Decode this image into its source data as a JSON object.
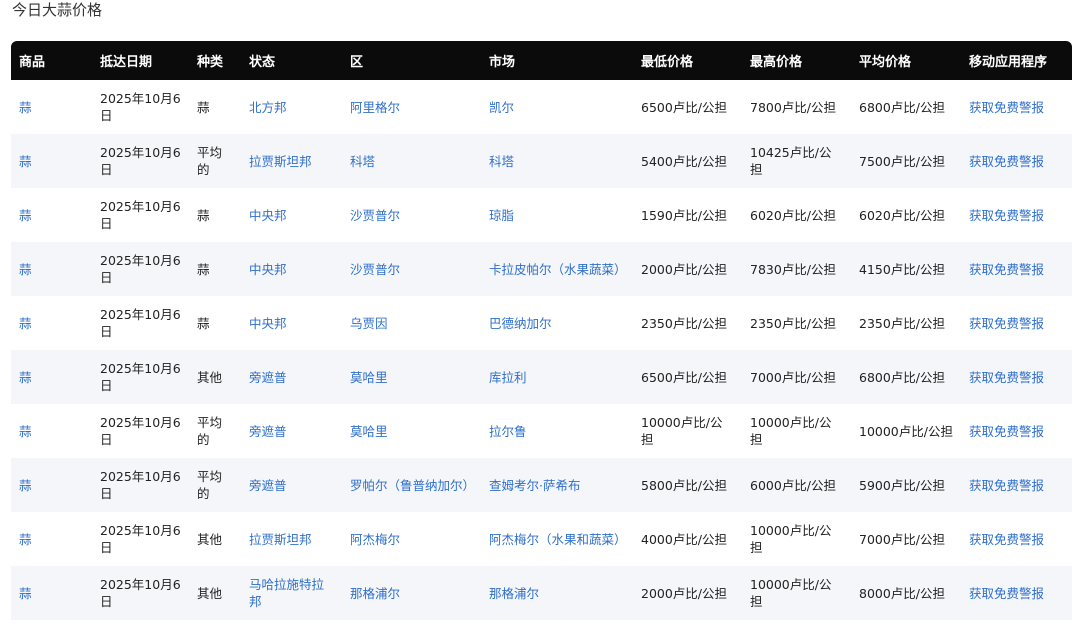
{
  "page": {
    "title": "今日大蒜价格"
  },
  "table": {
    "headers": [
      "商品",
      "抵达日期",
      "种类",
      "状态",
      "区",
      "市场",
      "最低价格",
      "最高价格",
      "平均价格",
      "移动应用程序"
    ],
    "rows": [
      [
        "蒜",
        "2025年10月6日",
        "蒜",
        "北方邦",
        "阿里格尔",
        "凯尔",
        "6500卢比/公担",
        "7800卢比/公担",
        "6800卢比/公担",
        "获取免费警报"
      ],
      [
        "蒜",
        "2025年10月6日",
        "平均的",
        "拉贾斯坦邦",
        "科塔",
        "科塔",
        "5400卢比/公担",
        "10425卢比/公担",
        "7500卢比/公担",
        "获取免费警报"
      ],
      [
        "蒜",
        "2025年10月6日",
        "蒜",
        "中央邦",
        "沙贾普尔",
        "琼脂",
        "1590卢比/公担",
        "6020卢比/公担",
        "6020卢比/公担",
        "获取免费警报"
      ],
      [
        "蒜",
        "2025年10月6日",
        "蒜",
        "中央邦",
        "沙贾普尔",
        "卡拉皮帕尔（水果蔬菜）",
        "2000卢比/公担",
        "7830卢比/公担",
        "4150卢比/公担",
        "获取免费警报"
      ],
      [
        "蒜",
        "2025年10月6日",
        "蒜",
        "中央邦",
        "乌贾因",
        "巴德纳加尔",
        "2350卢比/公担",
        "2350卢比/公担",
        "2350卢比/公担",
        "获取免费警报"
      ],
      [
        "蒜",
        "2025年10月6日",
        "其他",
        "旁遮普",
        "莫哈里",
        "库拉利",
        "6500卢比/公担",
        "7000卢比/公担",
        "6800卢比/公担",
        "获取免费警报"
      ],
      [
        "蒜",
        "2025年10月6日",
        "平均的",
        "旁遮普",
        "莫哈里",
        "拉尔鲁",
        "10000卢比/公担",
        "10000卢比/公担",
        "10000卢比/公担",
        "获取免费警报"
      ],
      [
        "蒜",
        "2025年10月6日",
        "平均的",
        "旁遮普",
        "罗帕尔（鲁普纳加尔）",
        "查姆考尔·萨希布",
        "5800卢比/公担",
        "6000卢比/公担",
        "5900卢比/公担",
        "获取免费警报"
      ],
      [
        "蒜",
        "2025年10月6日",
        "其他",
        "拉贾斯坦邦",
        "阿杰梅尔",
        "阿杰梅尔（水果和蔬菜）",
        "4000卢比/公担",
        "10000卢比/公担",
        "7000卢比/公担",
        "获取免费警报"
      ],
      [
        "蒜",
        "2025年10月6日",
        "其他",
        "马哈拉施特拉邦",
        "那格浦尔",
        "那格浦尔",
        "2000卢比/公担",
        "10000卢比/公担",
        "8000卢比/公担",
        "获取免费警报"
      ]
    ]
  }
}
